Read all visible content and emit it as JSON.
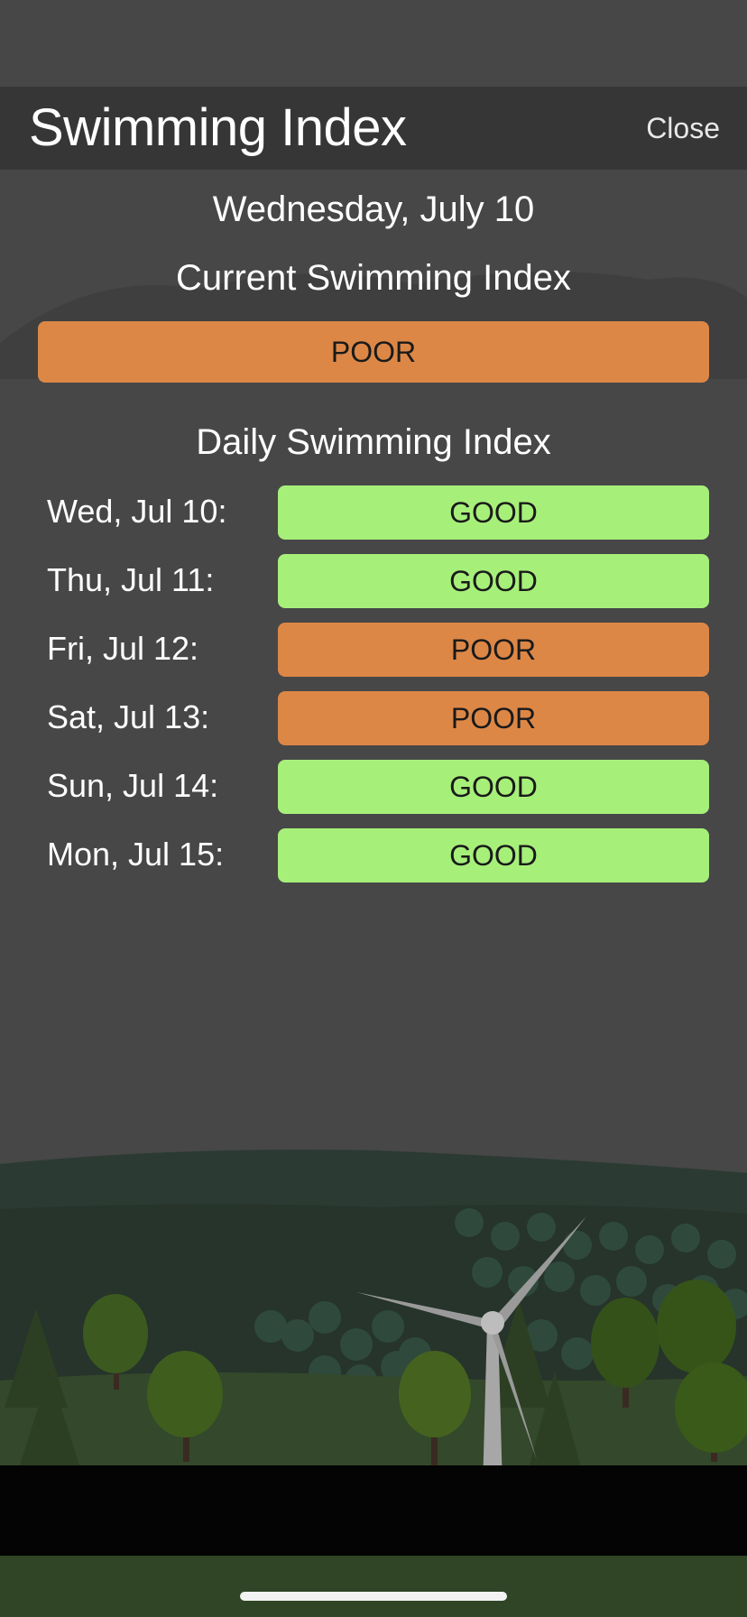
{
  "header": {
    "title": "Swimming Index",
    "close_label": "Close"
  },
  "date_heading": "Wednesday, July 10",
  "current": {
    "heading": "Current Swimming Index",
    "value": "POOR"
  },
  "daily": {
    "heading": "Daily Swimming Index",
    "days": [
      {
        "label": "Wed, Jul 10:",
        "value": "GOOD"
      },
      {
        "label": "Thu, Jul 11:",
        "value": "GOOD"
      },
      {
        "label": "Fri, Jul 12:",
        "value": "POOR"
      },
      {
        "label": "Sat, Jul 13:",
        "value": "POOR"
      },
      {
        "label": "Sun, Jul 14:",
        "value": "GOOD"
      },
      {
        "label": "Mon, Jul 15:",
        "value": "GOOD"
      }
    ]
  },
  "colors": {
    "good": "#a6f07a",
    "poor": "#dd8746",
    "header_bg": "#363636",
    "page_bg": "#474747"
  },
  "icons": {
    "scenery": "wind-turbine-landscape-illustration"
  }
}
